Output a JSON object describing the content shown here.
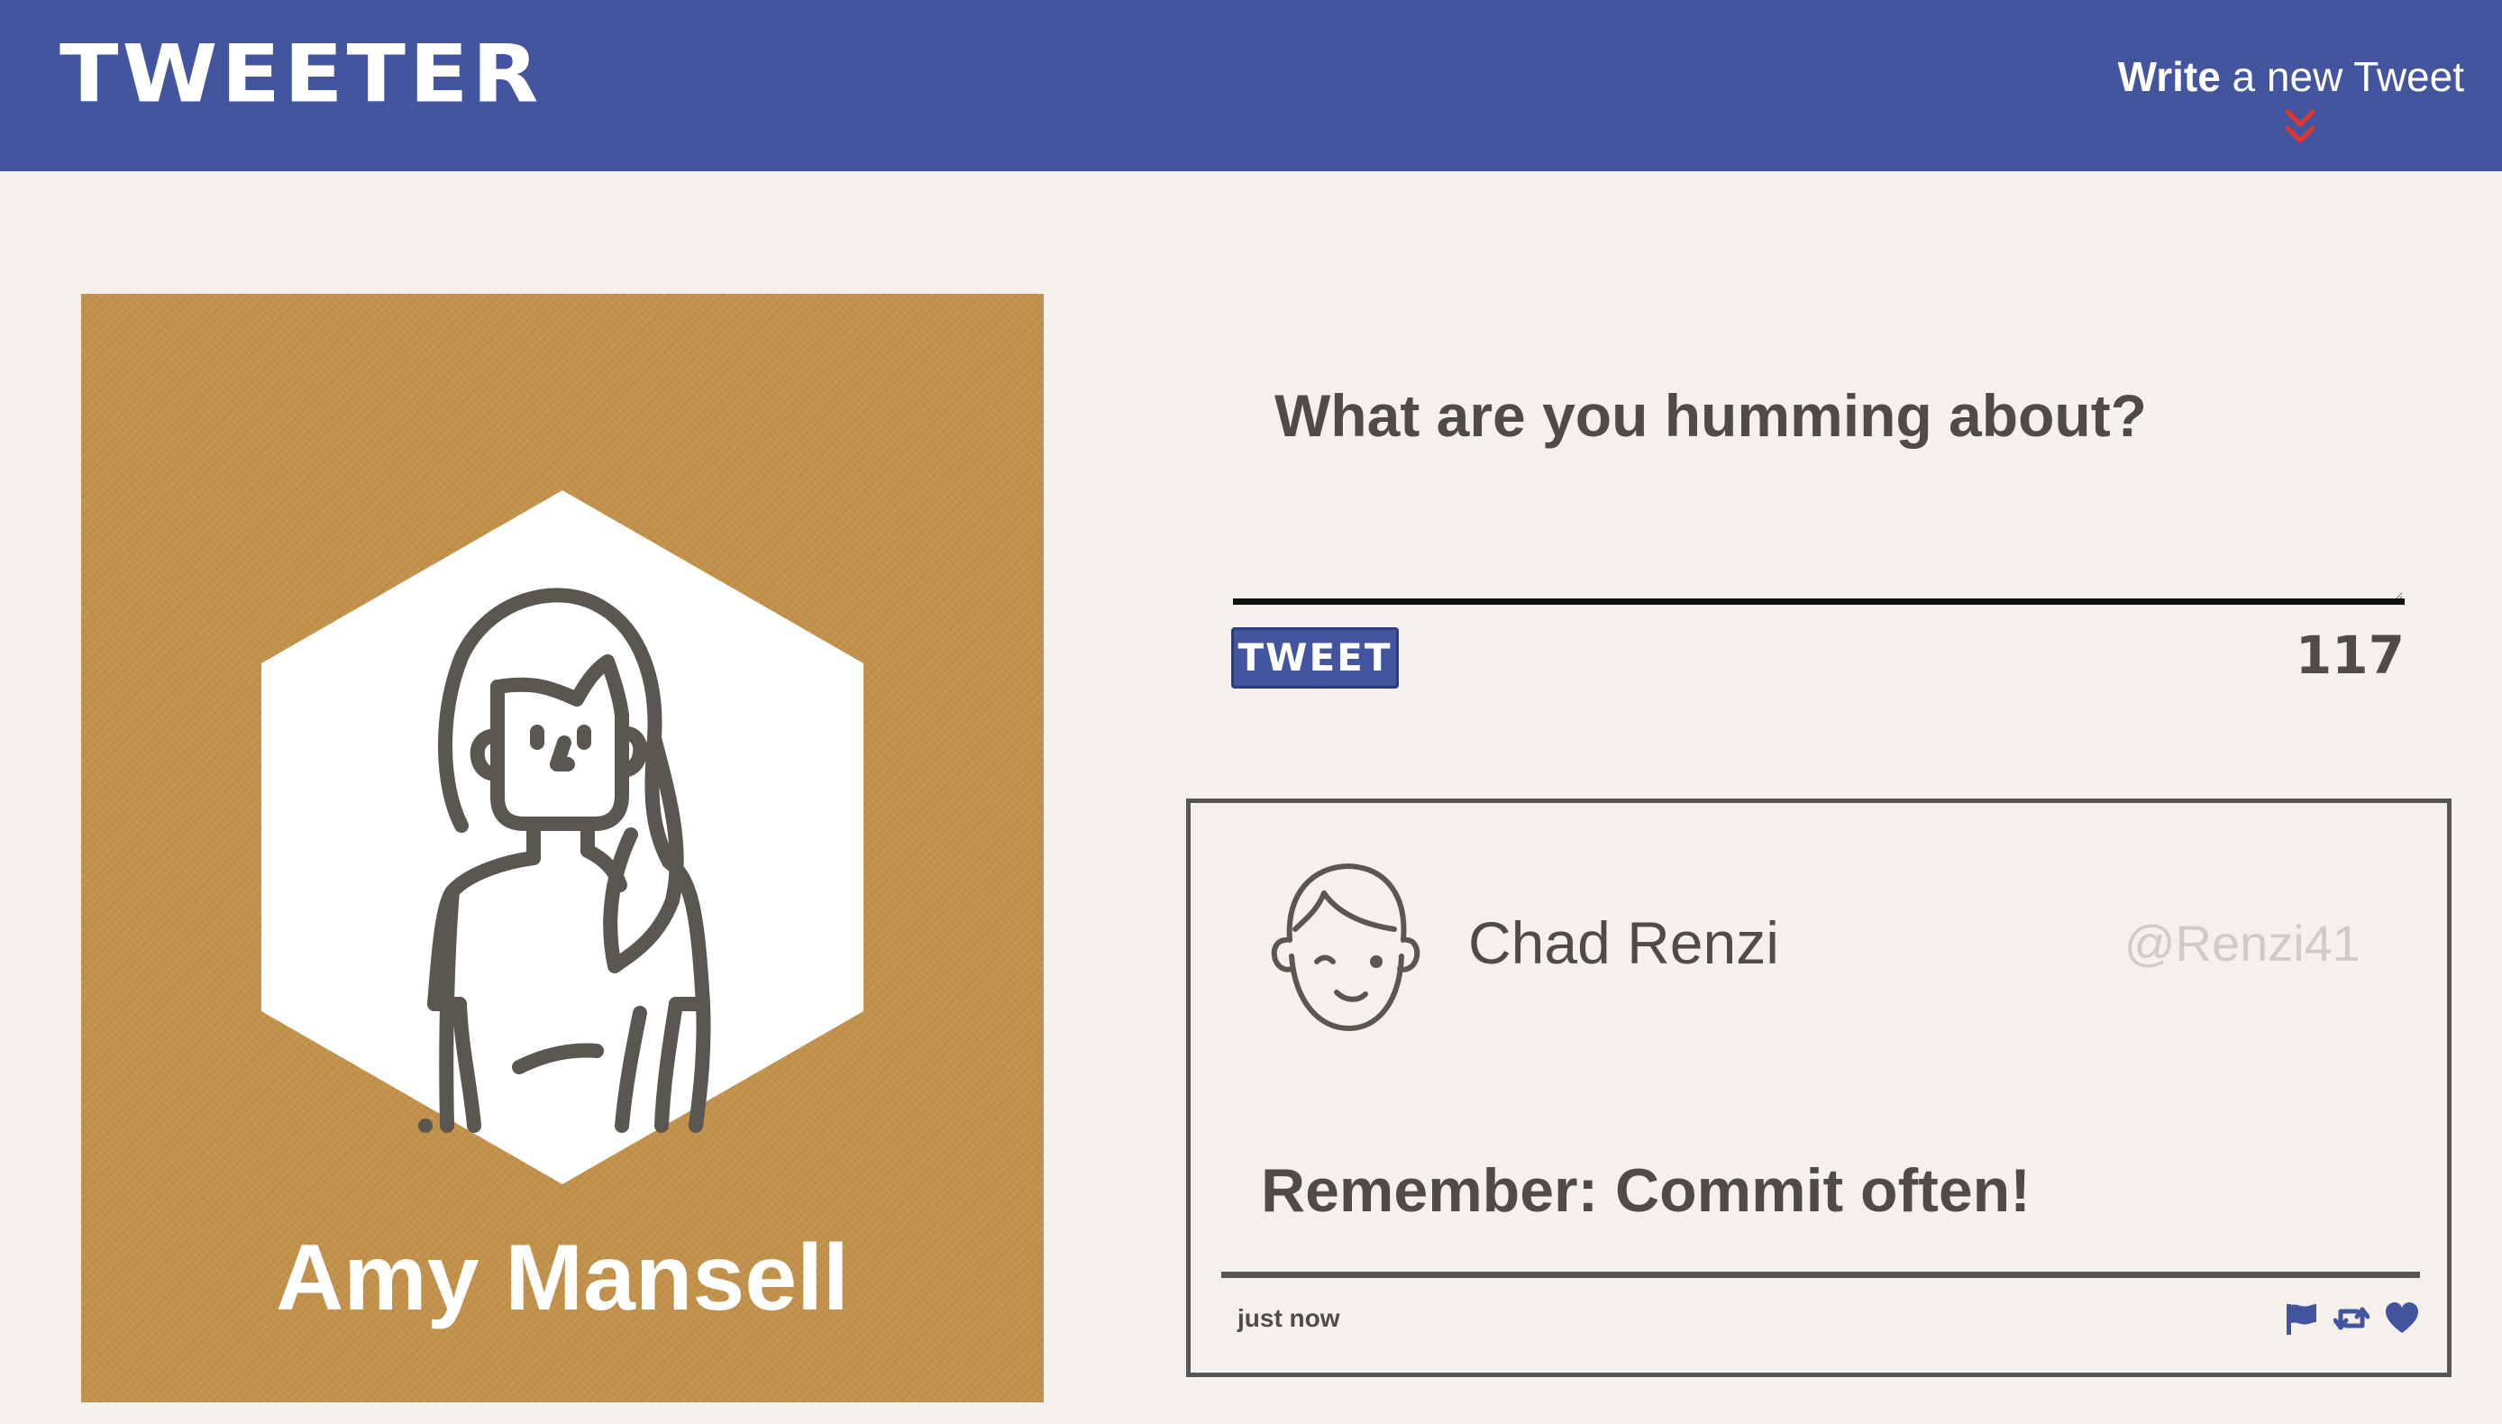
{
  "header": {
    "brand": "TWEETER",
    "compose_bold": "Write",
    "compose_rest": " a new Tweet"
  },
  "profile": {
    "name": "Amy Mansell"
  },
  "composer": {
    "prompt": "What are you humming about?",
    "value": "",
    "submit_label": "TWEET",
    "chars_remaining": "117"
  },
  "tweet": {
    "author": "Chad Renzi",
    "handle": "@Renzi41",
    "text": "Remember: Commit often!",
    "timestamp": "just now",
    "actions": [
      "flag-icon",
      "retweet-icon",
      "heart-icon"
    ]
  },
  "colors": {
    "header_bg": "#4455a0",
    "page_bg": "#f4f1ec",
    "profile_bg": "#c2914a",
    "chevron": "#e0342c",
    "action_icons": "#4455a0",
    "text": "#4f4b47"
  }
}
